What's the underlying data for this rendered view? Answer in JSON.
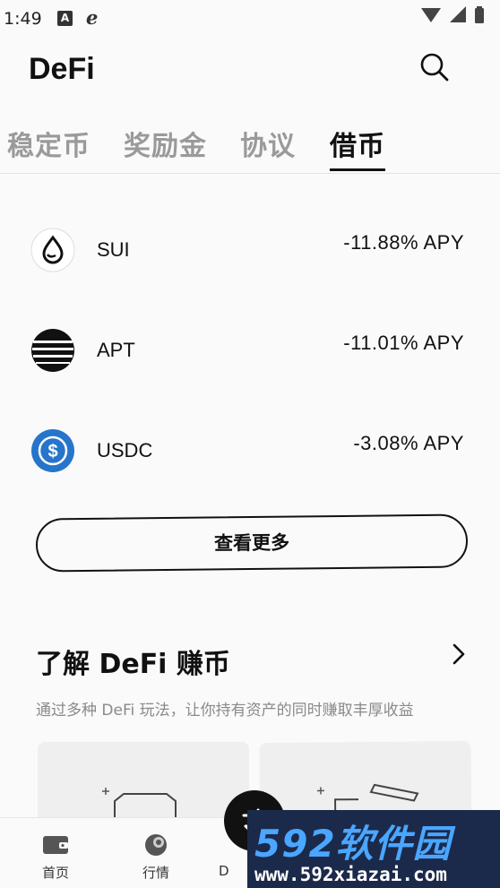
{
  "status_bar": {
    "time": "1:49",
    "notification_badge": "A"
  },
  "header": {
    "title": "DeFi"
  },
  "tabs": [
    {
      "label": "稳定币",
      "active": false
    },
    {
      "label": "奖励金",
      "active": false
    },
    {
      "label": "协议",
      "active": false
    },
    {
      "label": "借币",
      "active": true
    }
  ],
  "assets": [
    {
      "name": "SUI",
      "apy": "-11.88% APY",
      "icon": "sui-icon"
    },
    {
      "name": "APT",
      "apy": "-11.01% APY",
      "icon": "apt-icon"
    },
    {
      "name": "USDC",
      "apy": "-3.08% APY",
      "icon": "usdc-icon"
    }
  ],
  "more_button": {
    "label": "查看更多"
  },
  "learn": {
    "title": "了解 DeFi 赚币",
    "subtitle": "通过多种 DeFi 玩法，让你持有资产的同时赚取丰厚收益"
  },
  "bottom_nav": [
    {
      "label": "首页",
      "icon": "wallet-icon"
    },
    {
      "label": "行情",
      "icon": "market-icon"
    },
    {
      "label": "D",
      "icon": ""
    }
  ],
  "watermark": {
    "brand": "592软件园",
    "url": "www.592xiazai.com"
  },
  "colors": {
    "accent": "#111111",
    "tab_inactive": "#9a9a9a",
    "usdc_blue": "#2775ca",
    "watermark_blue": "#4aa6ff"
  }
}
